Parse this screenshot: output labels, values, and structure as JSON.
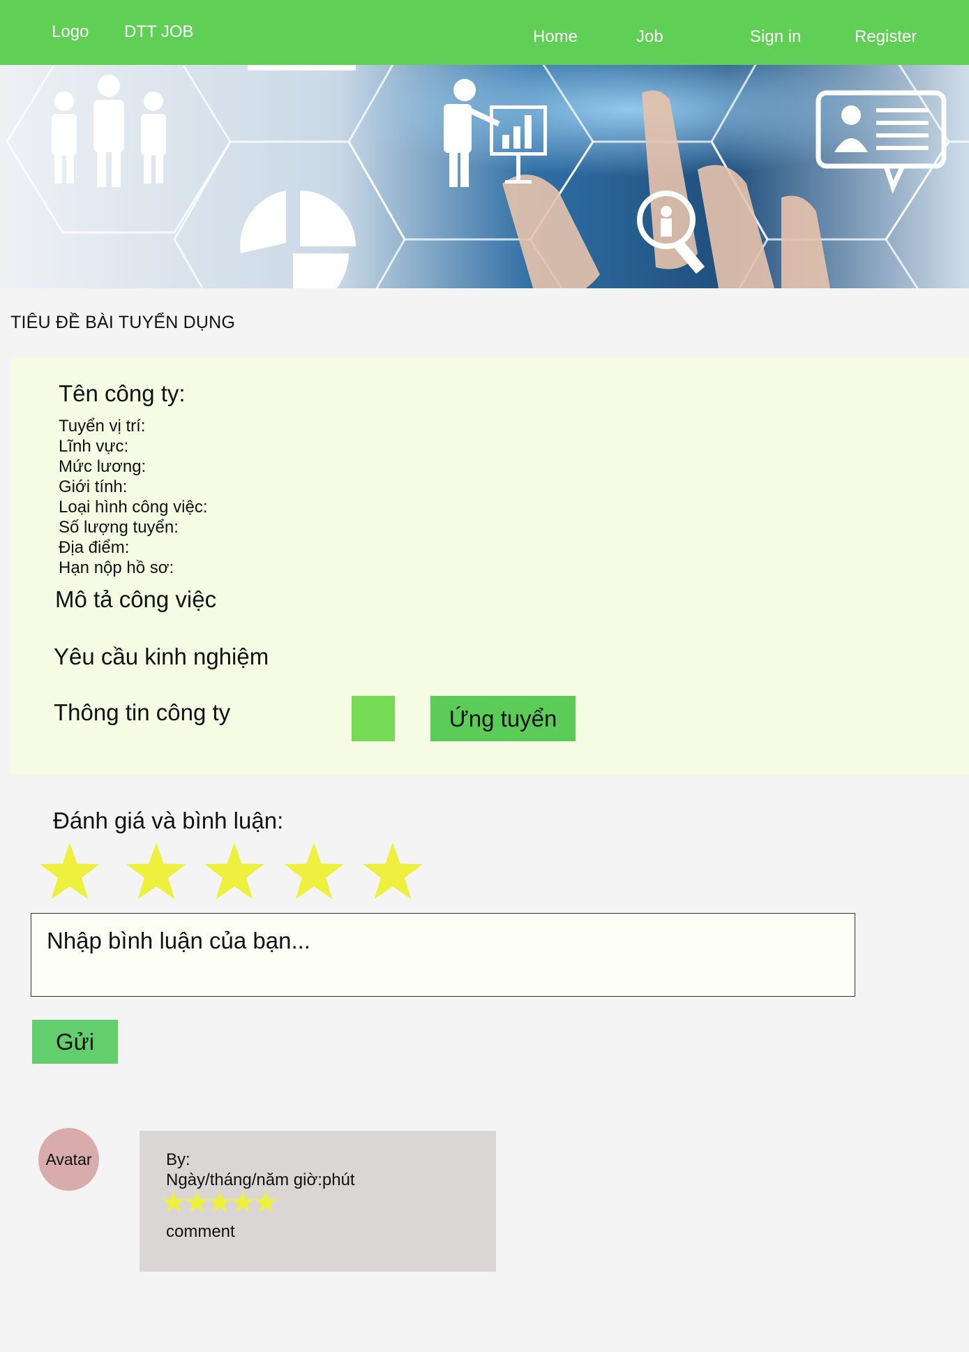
{
  "nav": {
    "logo": "Logo",
    "brand": "DTT JOB",
    "links": [
      "Home",
      "Job",
      "Sign in",
      "Register"
    ]
  },
  "post": {
    "title": "TIÊU ĐỀ BÀI TUYỂN DỤNG",
    "company_label": "Tên công ty:",
    "fields": [
      "Tuyển vị trí:",
      "Lĩnh vực:",
      "Mức lương:",
      "Giới tính:",
      "Loại hình công việc:",
      "Số lượng tuyển:",
      "Địa điểm:",
      "Hạn nộp hồ sơ:"
    ],
    "sections": {
      "description": "Mô tả công việc",
      "experience": "Yêu cầu kinh nghiệm",
      "company_info": "Thông tin công ty"
    },
    "apply_label": "Ứng tuyển"
  },
  "review": {
    "heading": "Đánh giá và bình luận:",
    "star_count": 5,
    "placeholder": "Nhập bình luận của bạn...",
    "send_label": "Gửi"
  },
  "comment": {
    "avatar_label": "Avatar",
    "by_label": "By:",
    "datetime": "Ngày/tháng/năm  giờ:phút",
    "rating": 5,
    "text": "comment"
  },
  "colors": {
    "nav_bg": "#5fd055",
    "star": "#eef03e",
    "panel_bg": "#f6fbe4",
    "apply_bg": "#5bcc57",
    "send_bg": "#62cf6c",
    "avatar_bg": "#d8acac",
    "comment_card_bg": "#dbd6d6"
  }
}
